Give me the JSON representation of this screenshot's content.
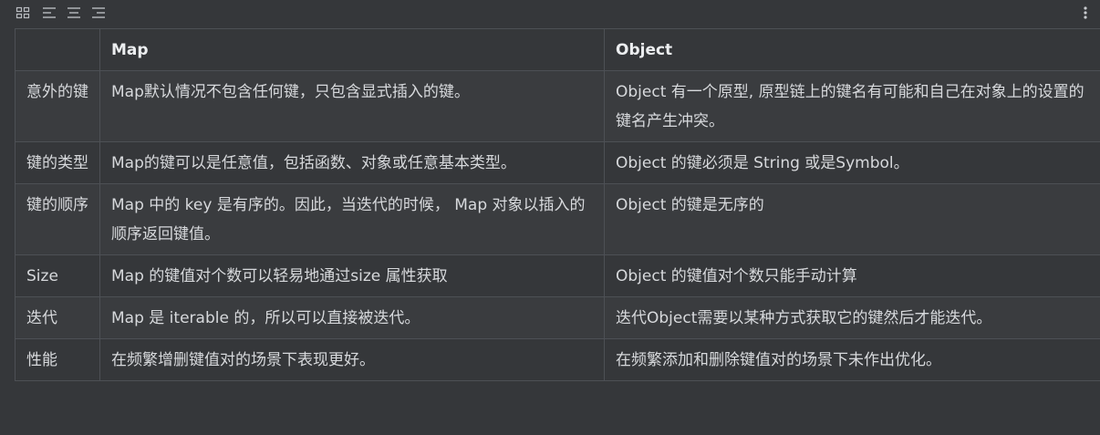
{
  "toolbar": {
    "icons": [
      "grid-view-icon",
      "align-left-icon",
      "align-center-icon",
      "align-right-icon",
      "more-vertical-icon"
    ]
  },
  "table": {
    "headers": [
      "",
      "Map",
      "Object"
    ],
    "rows": [
      [
        "意外的键",
        "Map默认情况不包含任何键，只包含显式插入的键。",
        "Object 有一个原型, 原型链上的键名有可能和自己在对象上的设置的键名产生冲突。"
      ],
      [
        "键的类型",
        "Map的键可以是任意值，包括函数、对象或任意基本类型。",
        "Object 的键必须是 String 或是Symbol。"
      ],
      [
        "键的顺序",
        "Map 中的 key 是有序的。因此，当迭代的时候， Map 对象以插入的顺序返回键值。",
        "Object 的键是无序的"
      ],
      [
        "Size",
        "Map 的键值对个数可以轻易地通过size 属性获取",
        "Object 的键值对个数只能手动计算"
      ],
      [
        "迭代",
        "Map 是 iterable 的，所以可以直接被迭代。",
        "迭代Object需要以某种方式获取它的键然后才能迭代。"
      ],
      [
        "性能",
        "在频繁增删键值对的场景下表现更好。",
        "在频繁添加和删除键值对的场景下未作出优化。"
      ]
    ]
  }
}
